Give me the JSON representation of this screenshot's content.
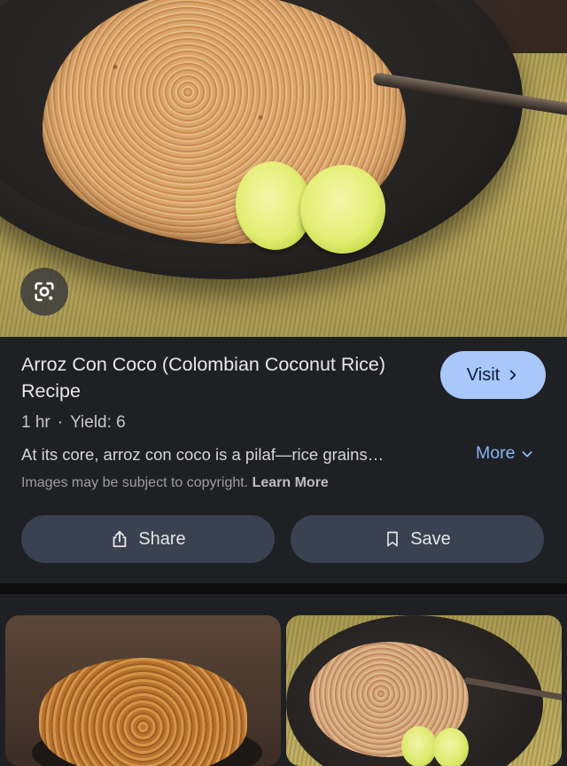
{
  "hero": {
    "alt_subject": "arroz con coco in a black oval dish with lime wedges",
    "lens_icon": "google-lens-icon"
  },
  "result": {
    "title": "Arroz Con Coco (Colombian Coconut Rice) Recipe",
    "visit_label": "Visit",
    "time": "1 hr",
    "separator": "·",
    "yield": "Yield: 6",
    "description": "At its core, arroz con coco is a pilaf—rice grains…",
    "more_label": "More",
    "copyright_text": "Images may be subject to copyright.",
    "learn_more_label": "Learn More",
    "share_label": "Share",
    "save_label": "Save"
  },
  "colors": {
    "background": "#1f2023",
    "visit_button": "#a8c7fa",
    "link": "#8ab4f8",
    "action_button": "#3a4150"
  }
}
